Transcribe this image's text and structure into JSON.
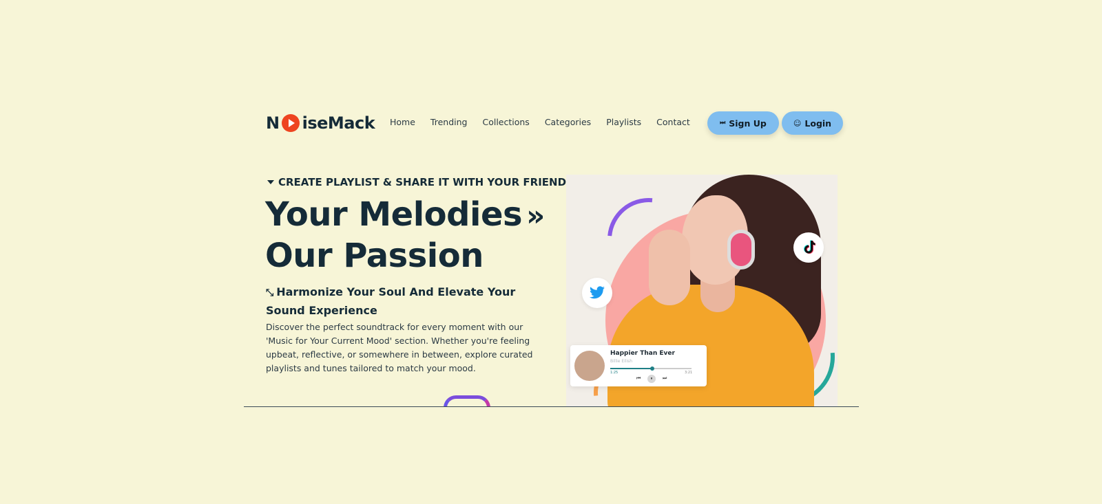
{
  "brand": {
    "prefix": "N",
    "suffix": "iseMack"
  },
  "nav": {
    "items": [
      {
        "label": "Home"
      },
      {
        "label": "Trending"
      },
      {
        "label": "Collections"
      },
      {
        "label": "Categories"
      },
      {
        "label": "Playlists"
      },
      {
        "label": "Contact"
      }
    ]
  },
  "auth": {
    "signup_label": "Sign Up",
    "login_label": "Login",
    "signup_icon": "⏭",
    "login_icon": "👤"
  },
  "hero": {
    "kicker": "CREATE PLAYLIST & SHARE IT WITH YOUR FRIENDS",
    "title_line1": "Your Melodies",
    "title_chevron": "»",
    "title_line2": "Our Passion",
    "subtitle": "Harmonize Your Soul And Elevate Your Sound Experience",
    "subtitle_icon": "⤡",
    "description": "Discover the perfect soundtrack for every moment with our 'Music for Your Current Mood' section. Whether you're feeling upbeat, reflective, or somewhere in between, explore curated playlists and tunes tailored to match your mood."
  },
  "player": {
    "song": "Happier Than Ever",
    "artist": "Billie Eilish",
    "elapsed": "1:25",
    "duration": "3:21",
    "progress_fraction": 0.52,
    "prev_icon": "⏮",
    "pause_icon": "⏸",
    "next_icon": "⏭"
  },
  "social": {
    "twitter_icon": "🐦",
    "tiktok_icon": "♪"
  },
  "colors": {
    "background": "#f7f5d7",
    "accent": "#7fbdef",
    "brand_red": "#ee4420",
    "text": "#152b38"
  }
}
